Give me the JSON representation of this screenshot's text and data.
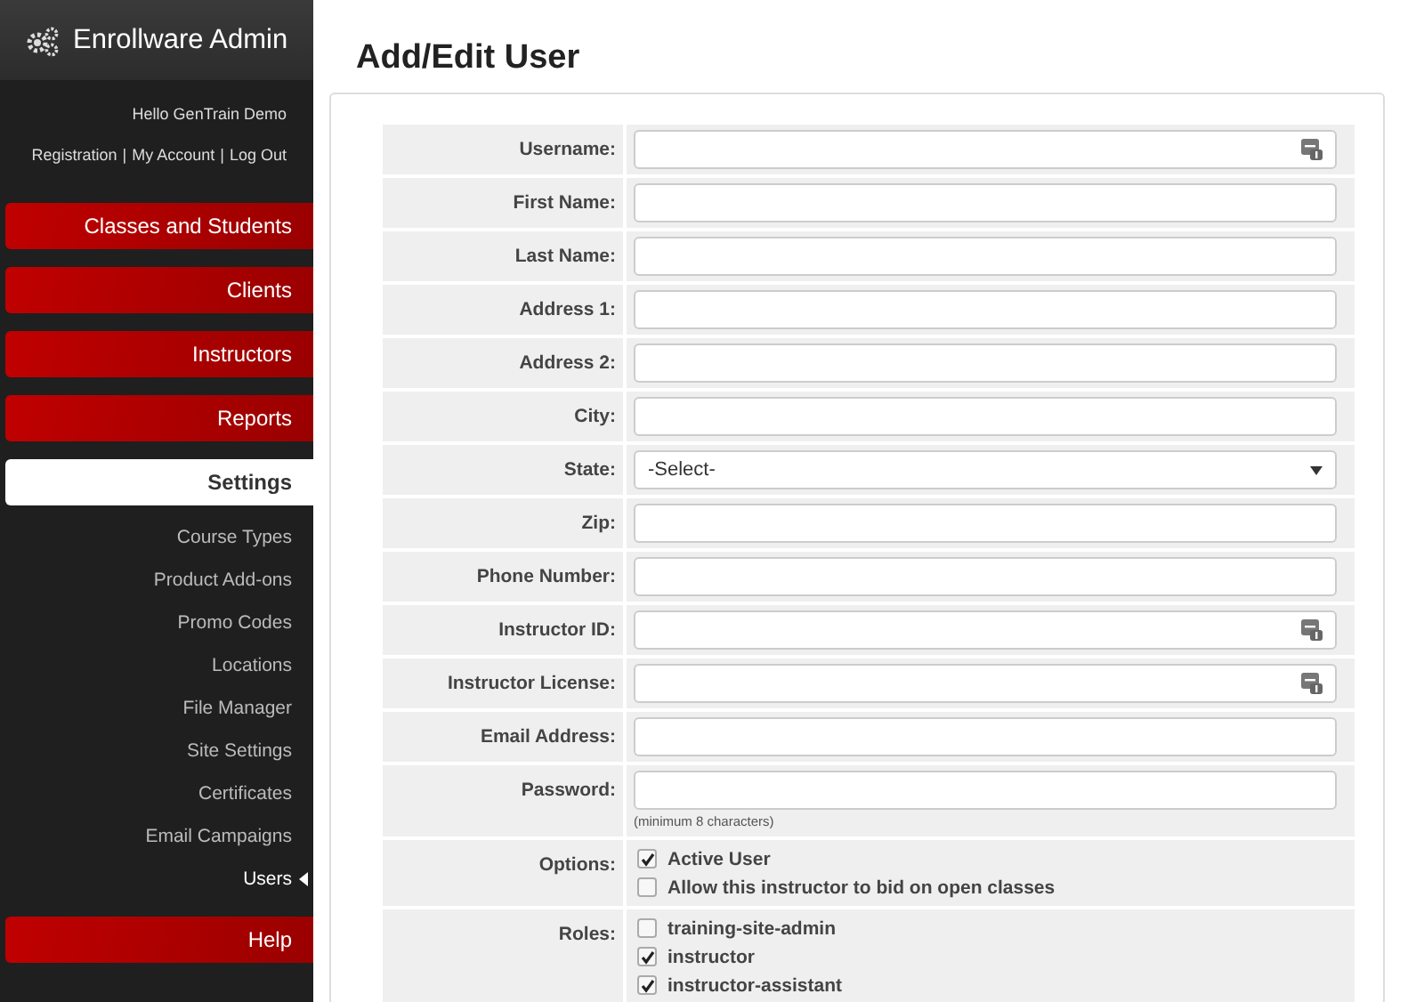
{
  "brand": {
    "title": "Enrollware Admin"
  },
  "greeting": "Hello GenTrain Demo",
  "account_links": [
    {
      "label": "Registration"
    },
    {
      "separator": "|",
      "label": "My Account"
    },
    {
      "separator": "|",
      "label": "Log Out"
    }
  ],
  "nav": [
    {
      "label": "Classes and Students",
      "kind": "main",
      "selected": false
    },
    {
      "label": "Clients",
      "kind": "main",
      "selected": false
    },
    {
      "label": "Instructors",
      "kind": "main",
      "selected": false
    },
    {
      "label": "Reports",
      "kind": "main",
      "selected": false
    },
    {
      "label": "Settings",
      "kind": "main",
      "selected": true,
      "children": [
        {
          "label": "Course Types",
          "selected": false
        },
        {
          "label": "Product Add-ons",
          "selected": false
        },
        {
          "label": "Promo Codes",
          "selected": false
        },
        {
          "label": "Locations",
          "selected": false
        },
        {
          "label": "File Manager",
          "selected": false
        },
        {
          "label": "Site Settings",
          "selected": false
        },
        {
          "label": "Certificates",
          "selected": false
        },
        {
          "label": "Email Campaigns",
          "selected": false
        },
        {
          "label": "Users",
          "selected": true
        }
      ]
    },
    {
      "label": "Help",
      "kind": "main",
      "selected": false
    }
  ],
  "page_title": "Add/Edit User",
  "form": [
    {
      "label": "Username:",
      "kind": "text",
      "icon": true
    },
    {
      "label": "First Name:",
      "kind": "text",
      "icon": false
    },
    {
      "label": "Last Name:",
      "kind": "text",
      "icon": false
    },
    {
      "label": "Address 1:",
      "kind": "text",
      "icon": false
    },
    {
      "label": "Address 2:",
      "kind": "text",
      "icon": false
    },
    {
      "label": "City:",
      "kind": "text",
      "icon": false
    },
    {
      "label": "State:",
      "kind": "select",
      "value": "-Select-"
    },
    {
      "label": "Zip:",
      "kind": "text",
      "icon": false
    },
    {
      "label": "Phone Number:",
      "kind": "text",
      "icon": false
    },
    {
      "label": "Instructor ID:",
      "kind": "text",
      "icon": true
    },
    {
      "label": "Instructor License:",
      "kind": "text",
      "icon": true
    },
    {
      "label": "Email Address:",
      "kind": "text",
      "icon": false
    },
    {
      "label": "Password:",
      "kind": "text",
      "icon": false,
      "hint": "(minimum 8 characters)"
    },
    {
      "label": "Options:",
      "kind": "checks",
      "items": [
        {
          "label": "Active User",
          "checked": true
        },
        {
          "label": "Allow this instructor to bid on open classes",
          "checked": false
        }
      ]
    },
    {
      "label": "Roles:",
      "kind": "checks",
      "items": [
        {
          "label": "training-site-admin",
          "checked": false
        },
        {
          "label": "instructor",
          "checked": true
        },
        {
          "label": "instructor-assistant",
          "checked": true
        }
      ]
    }
  ]
}
